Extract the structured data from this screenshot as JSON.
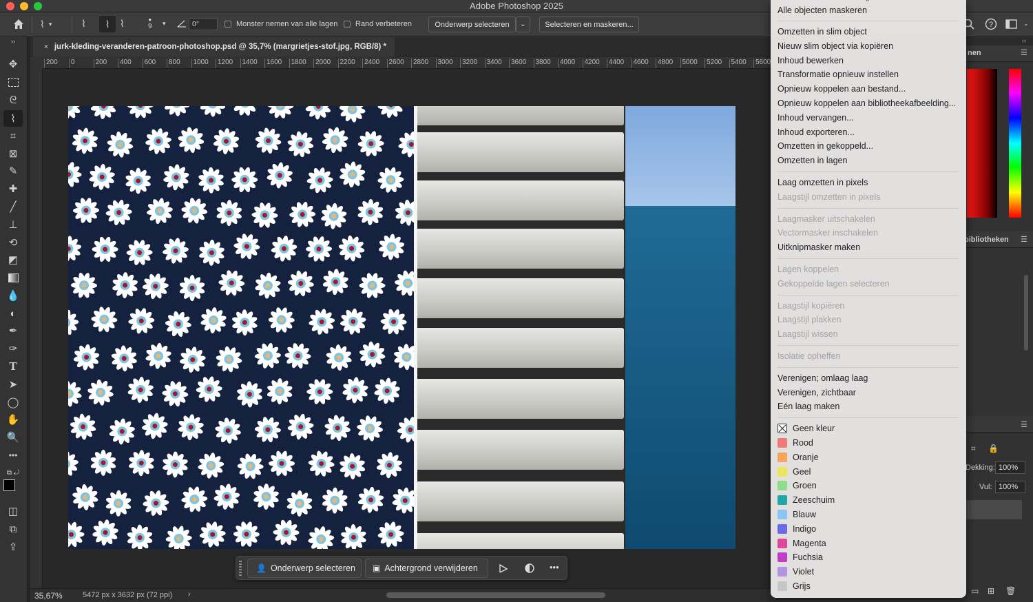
{
  "app": {
    "title": "Adobe Photoshop 2025"
  },
  "options_bar": {
    "brush_size": "9",
    "angle_value": "0°",
    "sample_all_layers_label": "Monster nemen van alle lagen",
    "enhance_edge_label": "Rand verbeteren",
    "select_subject_label": "Onderwerp selecteren",
    "select_and_mask_label": "Selecteren en maskeren..."
  },
  "document_tab": {
    "title": "jurk-kleding-veranderen-patroon-photoshop.psd @ 35,7% (margrietjes-stof.jpg, RGB/8) *"
  },
  "ruler": {
    "top_labels": [
      "200",
      "0",
      "200",
      "400",
      "600",
      "800",
      "1000",
      "1200",
      "1400",
      "1600",
      "1800",
      "2000",
      "2200",
      "2400",
      "2600",
      "2800",
      "3000",
      "3200",
      "3400",
      "3600",
      "3800",
      "4000",
      "4200",
      "4400",
      "4600",
      "4800",
      "5000",
      "5200",
      "5400",
      "5600"
    ]
  },
  "status": {
    "zoom": "35,67%",
    "doc_size": "5472 px x 3632 px (72 ppi)"
  },
  "taskbar": {
    "select_subject_label": "Onderwerp selecteren",
    "remove_background_label": "Achtergrond verwijderen"
  },
  "right_panel": {
    "panel1_title_fragment": "nen",
    "libraries_fragment": "bibliotheken",
    "opacity_label": "Dekking:",
    "opacity_value": "100%",
    "fill_label": "Vul:",
    "fill_value": "100%"
  },
  "context_menu": {
    "top_partial": "Alle objecten maskeren",
    "group1": [
      "Omzetten in slim object",
      "Nieuw slim object via kopiëren",
      "Inhoud bewerken",
      "Transformatie opnieuw instellen",
      "Opnieuw koppelen aan bestand...",
      "Opnieuw koppelen aan bibliotheekafbeelding...",
      "Inhoud vervangen...",
      "Inhoud exporteren...",
      "Omzetten in gekoppeld...",
      "Omzetten in lagen"
    ],
    "group2": [
      {
        "label": "Laag omzetten in pixels",
        "enabled": true
      },
      {
        "label": "Laagstijl omzetten in pixels",
        "enabled": false
      }
    ],
    "group3": [
      {
        "label": "Laagmasker uitschakelen",
        "enabled": false
      },
      {
        "label": "Vectormasker inschakelen",
        "enabled": false
      },
      {
        "label": "Uitknipmasker maken",
        "enabled": true
      }
    ],
    "group4": [
      {
        "label": "Lagen koppelen",
        "enabled": false
      },
      {
        "label": "Gekoppelde lagen selecteren",
        "enabled": false
      }
    ],
    "group5": [
      {
        "label": "Laagstijl kopiëren",
        "enabled": false
      },
      {
        "label": "Laagstijl plakken",
        "enabled": false
      },
      {
        "label": "Laagstijl wissen",
        "enabled": false
      }
    ],
    "group6": [
      {
        "label": "Isolatie opheffen",
        "enabled": false
      }
    ],
    "group7": [
      "Verenigen; omlaag laag",
      "Verenigen, zichtbaar",
      "Eén laag maken"
    ],
    "colors": [
      {
        "label": "Geen kleur",
        "color": "none"
      },
      {
        "label": "Rood",
        "color": "#f07a78"
      },
      {
        "label": "Oranje",
        "color": "#f5a55a"
      },
      {
        "label": "Geel",
        "color": "#ece65e"
      },
      {
        "label": "Groen",
        "color": "#8fdc8a"
      },
      {
        "label": "Zeeschuim",
        "color": "#23a7a4"
      },
      {
        "label": "Blauw",
        "color": "#8cc4f5"
      },
      {
        "label": "Indigo",
        "color": "#6a6ae6"
      },
      {
        "label": "Magenta",
        "color": "#e0479a"
      },
      {
        "label": "Fuchsia",
        "color": "#c23cc9"
      },
      {
        "label": "Violet",
        "color": "#b195e3"
      },
      {
        "label": "Grijs",
        "color": "#c6c6c6"
      }
    ]
  }
}
